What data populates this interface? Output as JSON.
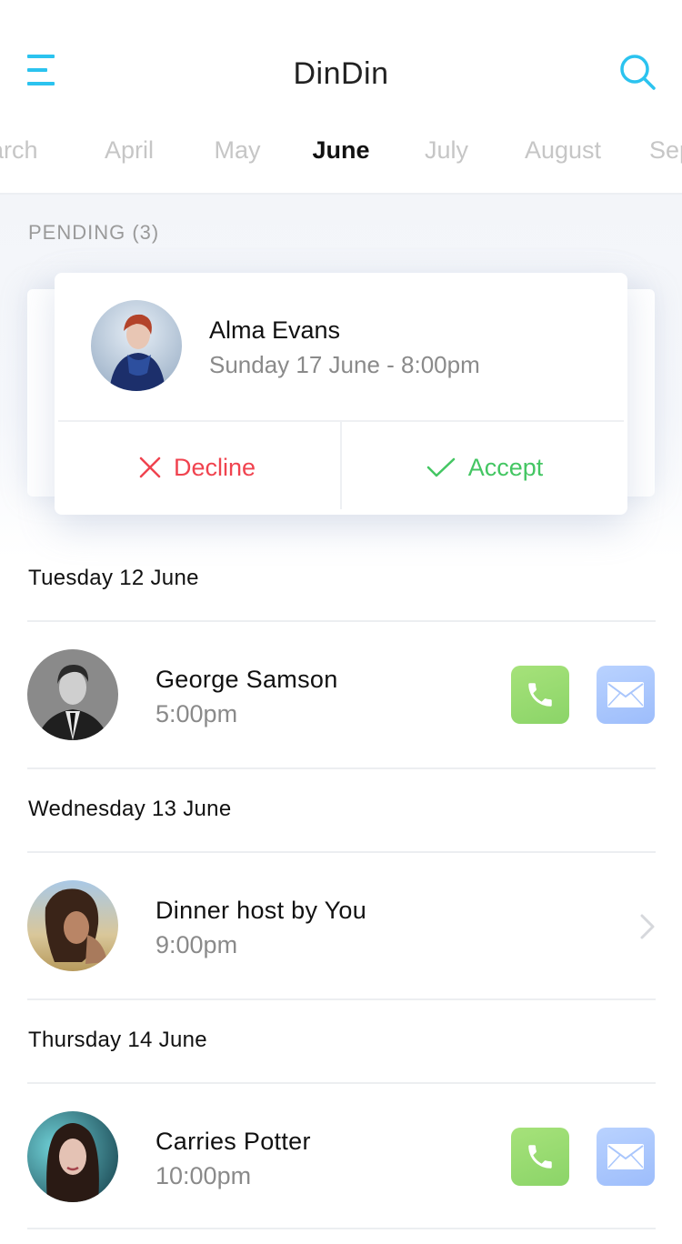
{
  "app": {
    "title": "DinDin"
  },
  "colors": {
    "accent": "#2bc3ef",
    "decline": "#f0434f",
    "accept": "#44c663"
  },
  "months": {
    "items": [
      "March",
      "April",
      "May",
      "June",
      "July",
      "August",
      "September"
    ],
    "selected": "June"
  },
  "pending": {
    "label": "PENDING (3)",
    "card": {
      "name": "Alma Evans",
      "datetime": "Sunday 17 June - 8:00pm",
      "decline_label": "Decline",
      "accept_label": "Accept"
    }
  },
  "schedule": [
    {
      "day": "Tuesday 12 June",
      "title": "George Samson",
      "time": "5:00pm",
      "actions": [
        "phone-icon",
        "mail-icon"
      ]
    },
    {
      "day": "Wednesday 13 June",
      "title": "Dinner host by You",
      "time": "9:00pm",
      "actions": [
        "chevron-right-icon"
      ]
    },
    {
      "day": "Thursday 14 June",
      "title": "Carries Potter",
      "time": "10:00pm",
      "actions": [
        "phone-icon",
        "mail-icon"
      ]
    }
  ]
}
